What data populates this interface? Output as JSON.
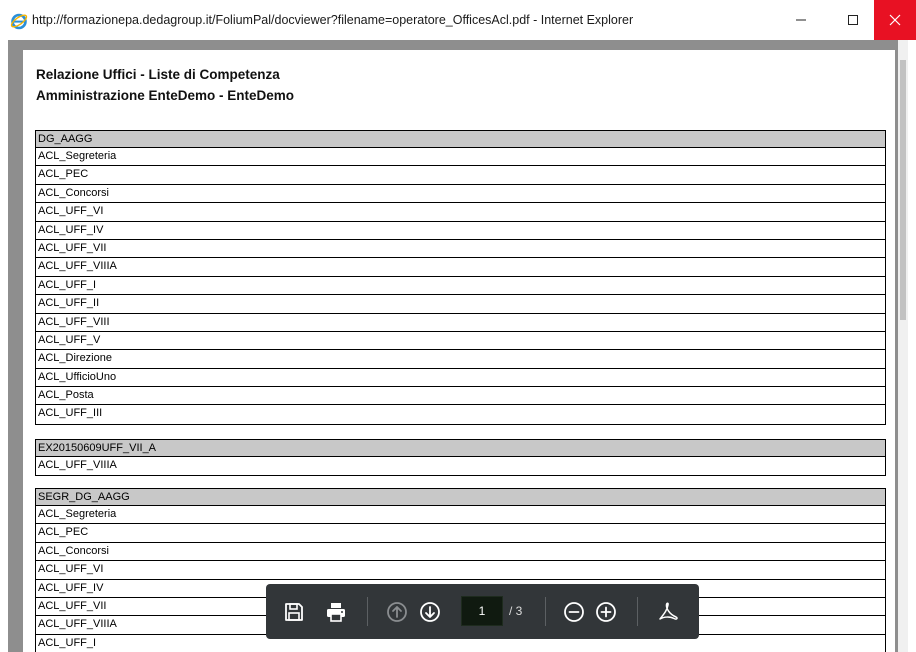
{
  "window": {
    "title": "http://formazionepa.dedagroup.it/FoliumPal/docviewer?filename=operatore_OfficesAcl.pdf - Internet Explorer"
  },
  "document": {
    "title_line1": "Relazione Uffici - Liste di Competenza",
    "title_line2": "Amministrazione EnteDemo - EnteDemo",
    "groups": [
      {
        "header": "DG_AAGG",
        "rows": [
          "ACL_Segreteria",
          "ACL_PEC",
          "ACL_Concorsi",
          "ACL_UFF_VI",
          "ACL_UFF_IV",
          "ACL_UFF_VII",
          "ACL_UFF_VIIIA",
          "ACL_UFF_I",
          "ACL_UFF_II",
          "ACL_UFF_VIII",
          "ACL_UFF_V",
          "ACL_Direzione",
          "ACL_UfficioUno",
          "ACL_Posta",
          "ACL_UFF_III"
        ]
      },
      {
        "header": "EX20150609UFF_VII_A",
        "rows": [
          "ACL_UFF_VIIIA"
        ]
      },
      {
        "header": "SEGR_DG_AAGG",
        "rows": [
          "ACL_Segreteria",
          "ACL_PEC",
          "ACL_Concorsi",
          "ACL_UFF_VI",
          "ACL_UFF_IV",
          "ACL_UFF_VII",
          "ACL_UFF_VIIIA",
          "ACL_UFF_I"
        ]
      }
    ]
  },
  "toolbar": {
    "current_page": "1",
    "total_pages": "/ 3"
  },
  "icons": {
    "save": "save-icon",
    "print": "print-icon",
    "prev": "arrow-up-circle-icon",
    "next": "arrow-down-circle-icon",
    "zoom_out": "minus-circle-icon",
    "zoom_in": "plus-circle-icon",
    "acrobat": "acrobat-icon"
  },
  "colors": {
    "close_button": "#e81123",
    "toolbar_bg": "#323639",
    "viewer_bg": "#8e8e8e",
    "group_header_bg": "#c8c8c8"
  }
}
